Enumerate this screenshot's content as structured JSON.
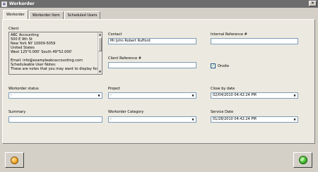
{
  "window": {
    "title": "Workorder",
    "close_label": "✕"
  },
  "tabs": [
    {
      "label": "Workorder",
      "active": true
    },
    {
      "label": "Workorder Item",
      "active": false
    },
    {
      "label": "Scheduled Users",
      "active": false
    }
  ],
  "client": {
    "label": "Client",
    "lines": [
      "ABC Accounting",
      "500 E 9th St",
      "New York NY  10009-5059",
      "United States",
      "West 125°0.000'  South 49°52.000'",
      "",
      "Email: info@exampleabcaccounting.com",
      "Scheduleable User Notes:",
      "These are notes that you may want to display for the"
    ]
  },
  "contact": {
    "label": "Contact",
    "value": "Mr John Robert Rufford"
  },
  "internal_reference": {
    "label": "Internal Reference #",
    "value": ""
  },
  "client_reference": {
    "label": "Client Reference #",
    "value": ""
  },
  "onsite": {
    "label": "Onsite",
    "checked": true,
    "mark": "✓"
  },
  "workorder_status": {
    "label": "Workorder status",
    "value": "-"
  },
  "project": {
    "label": "Project",
    "value": "-"
  },
  "close_by_date": {
    "label": "Close by date",
    "value": "02/04/2010 04:42:24 PM"
  },
  "summary": {
    "label": "Summary",
    "value": ""
  },
  "workorder_category": {
    "label": "Workorder Category",
    "value": "-"
  },
  "service_date": {
    "label": "Service Date",
    "value": "01/28/2010 04:42:24 PM"
  },
  "icons": {
    "dropdown": "▼",
    "scroll_up": "▲",
    "scroll_down": "▼",
    "ok": "✓"
  }
}
